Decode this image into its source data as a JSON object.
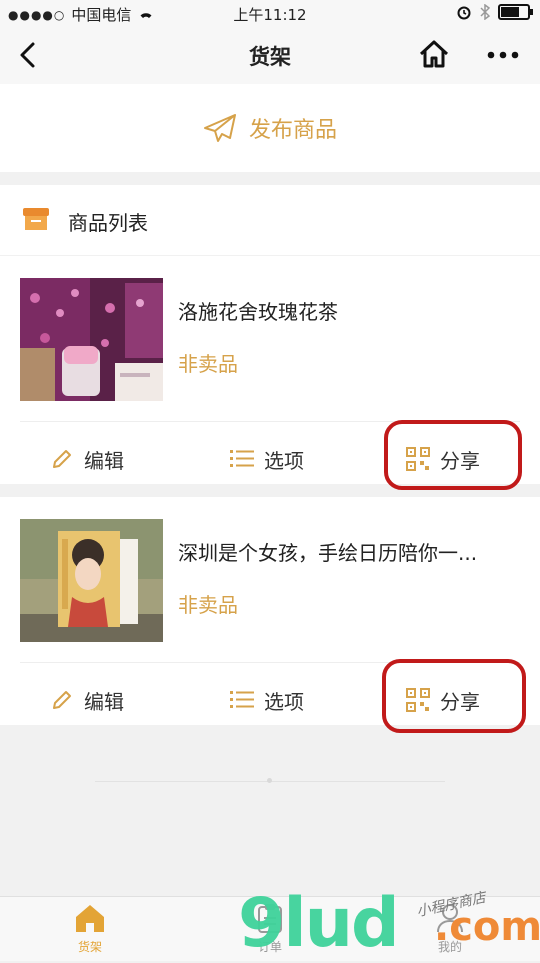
{
  "status_bar": {
    "signal": "●●●●○",
    "carrier": "中国电信",
    "time": "上午11:12"
  },
  "nav": {
    "title": "货架"
  },
  "publish": {
    "label": "发布商品"
  },
  "list": {
    "header": "商品列表",
    "products": [
      {
        "name": "洛施花舍玫瑰花茶",
        "status": "非卖品"
      },
      {
        "name": "深圳是个女孩，手绘日历陪你一...",
        "status": "非卖品"
      }
    ],
    "actions": {
      "edit": "编辑",
      "options": "选项",
      "share": "分享"
    }
  },
  "tabbar": {
    "items": [
      {
        "label": "货架",
        "active": true
      },
      {
        "label": "订单",
        "active": false
      },
      {
        "label": "我的",
        "active": false
      }
    ]
  },
  "watermark": {
    "main": "9lud",
    "sub": "小程序商店",
    "domain": ".com"
  },
  "colors": {
    "accent": "#d6a24a",
    "highlight_box": "#c11a1a",
    "watermark_green": "#3fd39b",
    "watermark_orange": "#ef8a37"
  }
}
